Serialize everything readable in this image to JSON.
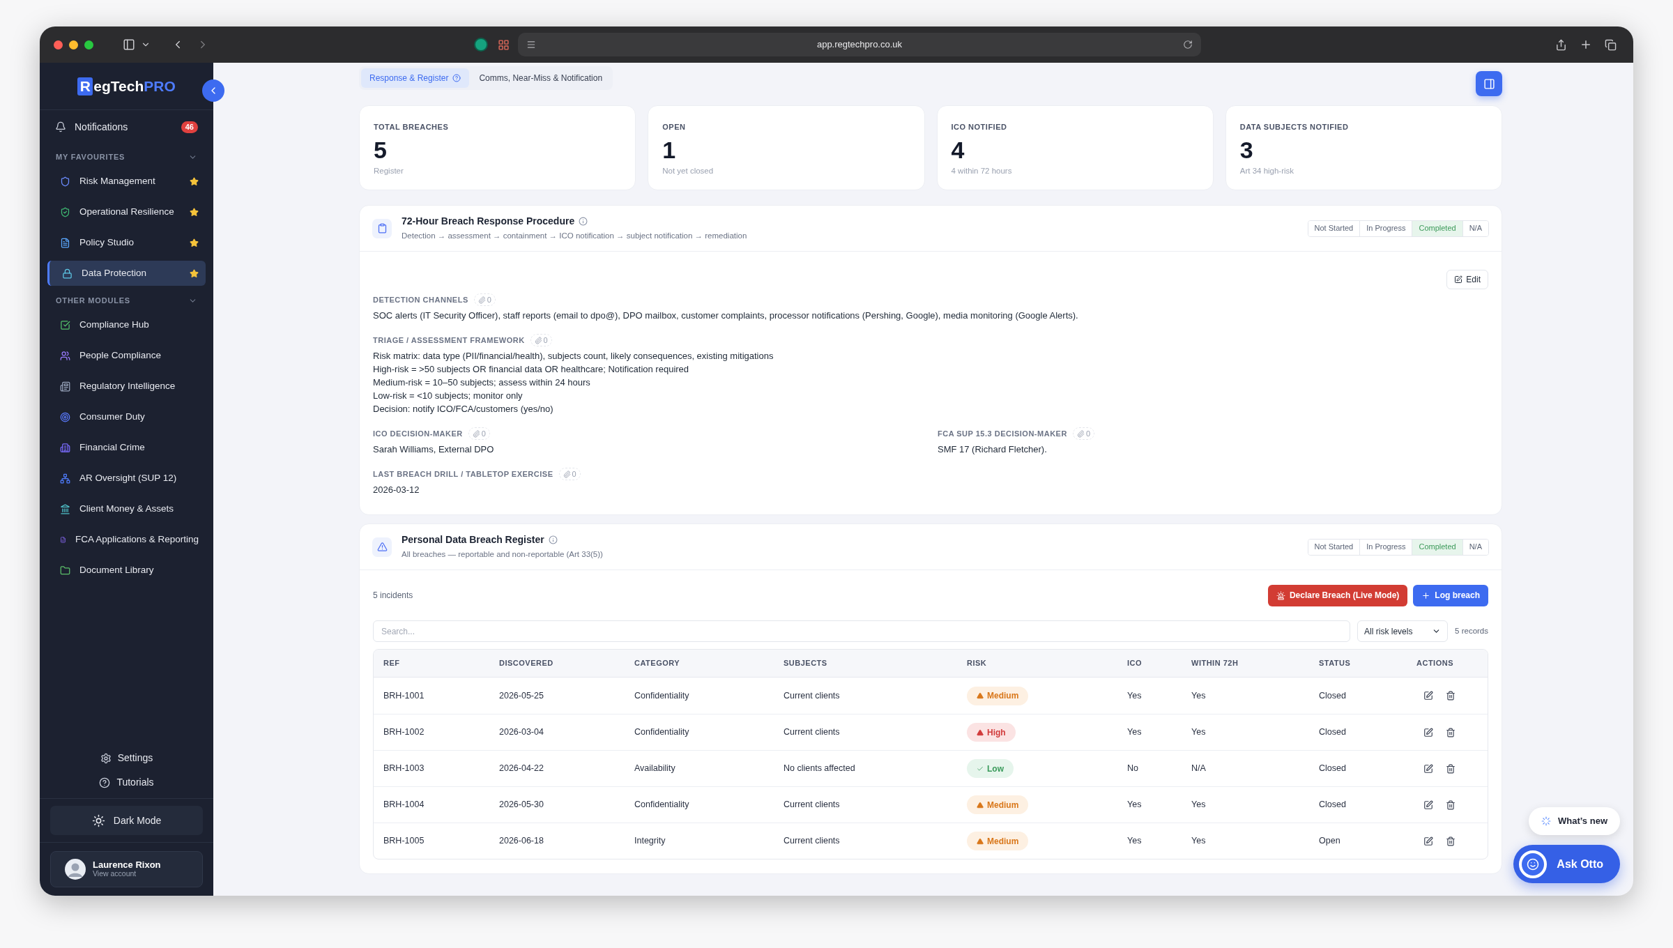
{
  "browser": {
    "url": "app.regtechpro.co.uk"
  },
  "sidebar": {
    "logo": {
      "mark": "R",
      "text": "egTech",
      "accent": "PRO"
    },
    "notifications": {
      "label": "Notifications",
      "count": "46"
    },
    "groups": [
      {
        "title": "MY FAVOURITES",
        "expanded": true,
        "items": [
          {
            "label": "Risk Management",
            "selected": false,
            "starred": true
          },
          {
            "label": "Operational Resilience",
            "selected": false,
            "starred": true
          },
          {
            "label": "Policy Studio",
            "selected": false,
            "starred": true
          },
          {
            "label": "Data Protection",
            "selected": true,
            "starred": true
          }
        ]
      },
      {
        "title": "OTHER MODULES",
        "expanded": true,
        "items": [
          {
            "label": "Compliance Hub",
            "selected": false,
            "starred": false
          },
          {
            "label": "People Compliance",
            "selected": false,
            "starred": false
          },
          {
            "label": "Regulatory Intelligence",
            "selected": false,
            "starred": false
          },
          {
            "label": "Consumer Duty",
            "selected": false,
            "starred": false
          },
          {
            "label": "Financial Crime",
            "selected": false,
            "starred": false
          },
          {
            "label": "AR Oversight (SUP 12)",
            "selected": false,
            "starred": false
          },
          {
            "label": "Client Money & Assets",
            "selected": false,
            "starred": false
          },
          {
            "label": "FCA Applications & Reporting",
            "selected": false,
            "starred": false
          },
          {
            "label": "Document Library",
            "selected": false,
            "starred": false
          }
        ]
      }
    ],
    "settings": "Settings",
    "tutorials": "Tutorials",
    "dark_mode": "Dark Mode",
    "user": {
      "name": "Laurence Rixon",
      "subtitle": "View account"
    }
  },
  "tabs": [
    {
      "label": "Response & Register",
      "selected": true
    },
    {
      "label": "Comms, Near-Miss & Notification",
      "selected": false
    }
  ],
  "stats": [
    {
      "label": "TOTAL BREACHES",
      "value": "5",
      "note": "Register"
    },
    {
      "label": "OPEN",
      "value": "1",
      "note": "Not yet closed"
    },
    {
      "label": "ICO NOTIFIED",
      "value": "4",
      "note": "4 within 72 hours"
    },
    {
      "label": "DATA SUBJECTS NOTIFIED",
      "value": "3",
      "note": "Art 34 high-risk"
    }
  ],
  "procedure": {
    "title": "72-Hour Breach Response Procedure",
    "subtitle": "Detection → assessment → containment → ICO notification → subject notification → remediation",
    "statuses": [
      {
        "label": "Not Started",
        "selected": false
      },
      {
        "label": "In Progress",
        "selected": false
      },
      {
        "label": "Completed",
        "selected": true
      },
      {
        "label": "N/A",
        "selected": false
      }
    ],
    "edit_button": "Edit",
    "rows": [
      [
        {
          "label": "DETECTION CHANNELS",
          "attachments": "0",
          "lines": [
            "SOC alerts (IT Security Officer), staff reports (email to dpo@), DPO mailbox, customer complaints, processor notifications (Pershing, Google), media monitoring (Google Alerts)."
          ]
        }
      ],
      [
        {
          "label": "TRIAGE / ASSESSMENT FRAMEWORK",
          "attachments": "0",
          "lines": [
            "Risk matrix: data type (PII/financial/health), subjects count, likely consequences, existing mitigations",
            "High-risk = >50 subjects OR financial data OR healthcare; Notification required",
            "Medium-risk = 10–50 subjects; assess within 24 hours",
            "Low-risk = <10 subjects; monitor only",
            "Decision: notify ICO/FCA/customers (yes/no)"
          ]
        }
      ],
      [
        {
          "label": "ICO DECISION-MAKER",
          "attachments": "0",
          "lines": [
            "Sarah Williams, External DPO"
          ]
        },
        {
          "label": "FCA SUP 15.3 DECISION-MAKER",
          "attachments": "0",
          "lines": [
            "SMF 17 (Richard Fletcher)."
          ]
        }
      ],
      [
        {
          "label": "LAST BREACH DRILL / TABLETOP EXERCISE",
          "attachments": "0",
          "lines": [
            "2026-03-12"
          ]
        }
      ]
    ]
  },
  "register": {
    "title": "Personal Data Breach Register",
    "subtitle": "All breaches — reportable and non-reportable (Art 33(5))",
    "statuses": [
      {
        "label": "Not Started",
        "selected": false
      },
      {
        "label": "In Progress",
        "selected": false
      },
      {
        "label": "Completed",
        "selected": true
      },
      {
        "label": "N/A",
        "selected": false
      }
    ],
    "count": "5 incidents",
    "declare_button": "Declare Breach (Live Mode)",
    "log_button": "Log breach",
    "search": {
      "placeholder": "Search..."
    },
    "filter": "All risk levels",
    "records": "5 records",
    "columns": [
      "REF",
      "DISCOVERED",
      "CATEGORY",
      "SUBJECTS",
      "RISK",
      "ICO",
      "WITHIN 72H",
      "STATUS",
      "ACTIONS"
    ],
    "rows": [
      {
        "ref": "BRH-1001",
        "discovered": "2026-05-25",
        "category": "Confidentiality",
        "subjects": "Current clients",
        "risk": {
          "label": "Medium",
          "kind": "medium"
        },
        "ico": "Yes",
        "within_72h": "Yes",
        "status": "Closed"
      },
      {
        "ref": "BRH-1002",
        "discovered": "2026-03-04",
        "category": "Confidentiality",
        "subjects": "Current clients",
        "risk": {
          "label": "High",
          "kind": "high"
        },
        "ico": "Yes",
        "within_72h": "Yes",
        "status": "Closed"
      },
      {
        "ref": "BRH-1003",
        "discovered": "2026-04-22",
        "category": "Availability",
        "subjects": "No clients affected",
        "risk": {
          "label": "Low",
          "kind": "low"
        },
        "ico": "No",
        "within_72h": "N/A",
        "status": "Closed"
      },
      {
        "ref": "BRH-1004",
        "discovered": "2026-05-30",
        "category": "Confidentiality",
        "subjects": "Current clients",
        "risk": {
          "label": "Medium",
          "kind": "medium"
        },
        "ico": "Yes",
        "within_72h": "Yes",
        "status": "Closed"
      },
      {
        "ref": "BRH-1005",
        "discovered": "2026-06-18",
        "category": "Integrity",
        "subjects": "Current clients",
        "risk": {
          "label": "Medium",
          "kind": "medium"
        },
        "ico": "Yes",
        "within_72h": "Yes",
        "status": "Open"
      }
    ]
  },
  "whats_new": "What’s new",
  "ask_otto": "Ask Otto"
}
